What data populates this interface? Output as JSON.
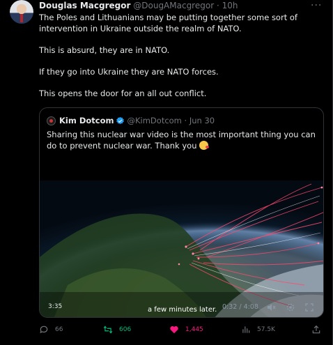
{
  "tweet": {
    "author_name": "Douglas Macgregor",
    "author_handle": "@DougAMacgregor",
    "time": "10h",
    "more": "···",
    "paragraphs": [
      "The Poles and Lithuanians may be putting together some sort of intervention in Ukraine outside the realm of NATO.",
      "This is absurd, they are in NATO.",
      "If they go into Ukraine they are NATO forces.",
      "This opens the door for an all out conflict."
    ]
  },
  "quote": {
    "author_name": "Kim Dotcom",
    "author_handle": "@KimDotcom",
    "time": "Jun 30",
    "text": "Sharing this nuclear war video is the most important thing you can do to prevent nuclear war. Thank you"
  },
  "video": {
    "duration": "3:35",
    "caption": "a few minutes later.",
    "progress": "0:32 / 4:08"
  },
  "actions": {
    "replies": "66",
    "retweets": "606",
    "likes": "1,445",
    "views": "57.5K"
  },
  "colors": {
    "retweet": "#00ba7c",
    "like": "#f91880",
    "verified": "#1d9bf0",
    "muted": "#71767b"
  }
}
